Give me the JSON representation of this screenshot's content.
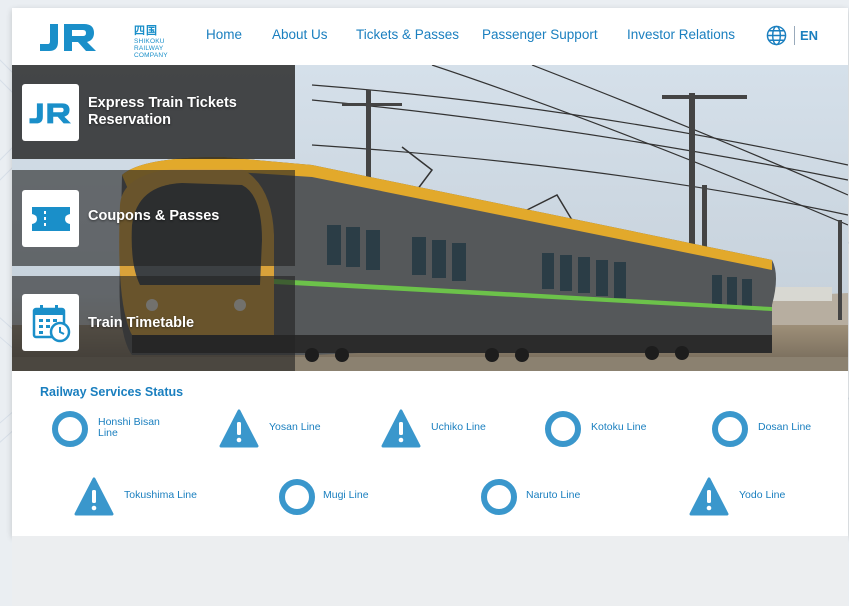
{
  "brand": {
    "logo_text": "JR",
    "kanji": "四国",
    "subtitle_line1": "SHIKOKU",
    "subtitle_line2": "RAILWAY COMPANY"
  },
  "nav": {
    "items": [
      {
        "label": "Home"
      },
      {
        "label": "About Us"
      },
      {
        "label": "Tickets & Passes"
      },
      {
        "label": "Passenger Support"
      },
      {
        "label": "Investor Relations"
      }
    ],
    "lang": "EN"
  },
  "hero_menu": {
    "items": [
      {
        "label_line1": "Express Train Tickets",
        "label_line2": "Reservation",
        "icon": "jr-logo-icon"
      },
      {
        "label_line1": "Coupons & Passes",
        "label_line2": "",
        "icon": "ticket-icon"
      },
      {
        "label_line1": "Train Timetable",
        "label_line2": "",
        "icon": "calendar-clock-icon"
      }
    ]
  },
  "status": {
    "title": "Railway Services Status",
    "lines": [
      {
        "name_line1": "Honshi Bisan",
        "name_line2": "Line",
        "status_icon": "normal-circle-icon"
      },
      {
        "name_line1": "Yosan Line",
        "name_line2": "",
        "status_icon": "warning-icon"
      },
      {
        "name_line1": "Uchiko Line",
        "name_line2": "",
        "status_icon": "warning-icon"
      },
      {
        "name_line1": "Kotoku Line",
        "name_line2": "",
        "status_icon": "normal-circle-icon"
      },
      {
        "name_line1": "Dosan Line",
        "name_line2": "",
        "status_icon": "normal-circle-icon"
      },
      {
        "name_line1": "Tokushima Line",
        "name_line2": "",
        "status_icon": "warning-icon"
      },
      {
        "name_line1": "Mugi Line",
        "name_line2": "",
        "status_icon": "normal-circle-icon"
      },
      {
        "name_line1": "Naruto Line",
        "name_line2": "",
        "status_icon": "normal-circle-icon"
      },
      {
        "name_line1": "Yodo Line",
        "name_line2": "",
        "status_icon": "warning-icon"
      }
    ]
  },
  "colors": {
    "brand_blue": "#1a8fc9",
    "nav_text": "#1a7fbf",
    "status_icon": "#3a97cc"
  }
}
